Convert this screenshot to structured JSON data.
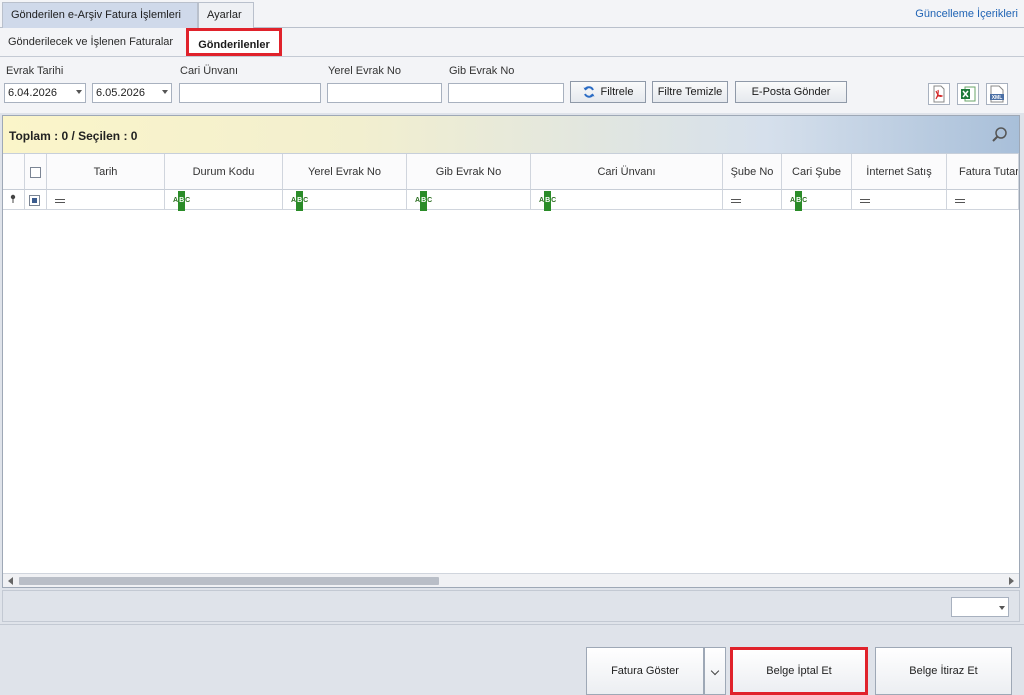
{
  "top_tabs": [
    {
      "label": "Gönderilen e-Arşiv Fatura İşlemleri",
      "active": true
    },
    {
      "label": "Ayarlar",
      "active": false
    }
  ],
  "update_link": "Güncelleme İçerikleri",
  "sub_tabs": [
    {
      "label": "Gönderilecek ve İşlenen Faturalar"
    },
    {
      "label": "Gönderilenler"
    }
  ],
  "filters": {
    "evrak_tarihi_label": "Evrak Tarihi",
    "date_from": "6.04.2026",
    "date_to": "6.05.2026",
    "cari_unvani_label": "Cari Ünvanı",
    "cari_unvani_value": "",
    "yerel_evrak_no_label": "Yerel Evrak No",
    "yerel_evrak_no_value": "",
    "gib_evrak_no_label": "Gib Evrak No",
    "gib_evrak_no_value": ""
  },
  "buttons": {
    "filtrele": "Filtrele",
    "filtre_temizle": "Filtre Temizle",
    "eposta_gonder": "E-Posta Gönder"
  },
  "export_icons": [
    "pdf-icon",
    "excel-icon",
    "xml-icon"
  ],
  "export_xml_label": "XML",
  "summary": "Toplam : 0 / Seçilen : 0",
  "columns": [
    "Tarih",
    "Durum Kodu",
    "Yerel Evrak No",
    "Gib Evrak No",
    "Cari Ünvanı",
    "Şube No",
    "Cari Şube",
    "İnternet Satış",
    "Fatura Tutarı"
  ],
  "filter_row_types": [
    "eq",
    "abc",
    "abc",
    "abc",
    "abc",
    "eq",
    "abc",
    "eq",
    "eq"
  ],
  "abc_label": "ABC",
  "actions": {
    "fatura_goster": "Fatura Göster",
    "belge_iptal": "Belge İptal Et",
    "belge_itiraz": "Belge İtiraz Et"
  },
  "colors": {
    "highlight": "#e0222b",
    "link": "#1f63b4",
    "active_tab": "#cfd9ea"
  }
}
